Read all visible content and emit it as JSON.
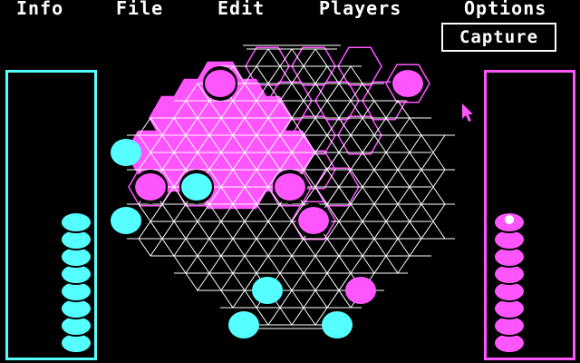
{
  "menu": {
    "items": [
      "Info",
      "File",
      "Edit",
      "Players",
      "Options"
    ]
  },
  "mode_button": {
    "label": "Capture"
  },
  "colors": {
    "background": "#000000",
    "cyan": "#55ffff",
    "magenta": "#ff55ff",
    "white": "#ffffff"
  },
  "trays": {
    "left": {
      "color": "cyan",
      "pieces": 8
    },
    "right": {
      "color": "magenta",
      "pieces": 8,
      "selected_top": true
    }
  },
  "board": {
    "captured_hex_fill": "magenta",
    "outlined_hex_color": "magenta"
  },
  "cursor": {
    "icon": "arrow-pointer-icon"
  }
}
